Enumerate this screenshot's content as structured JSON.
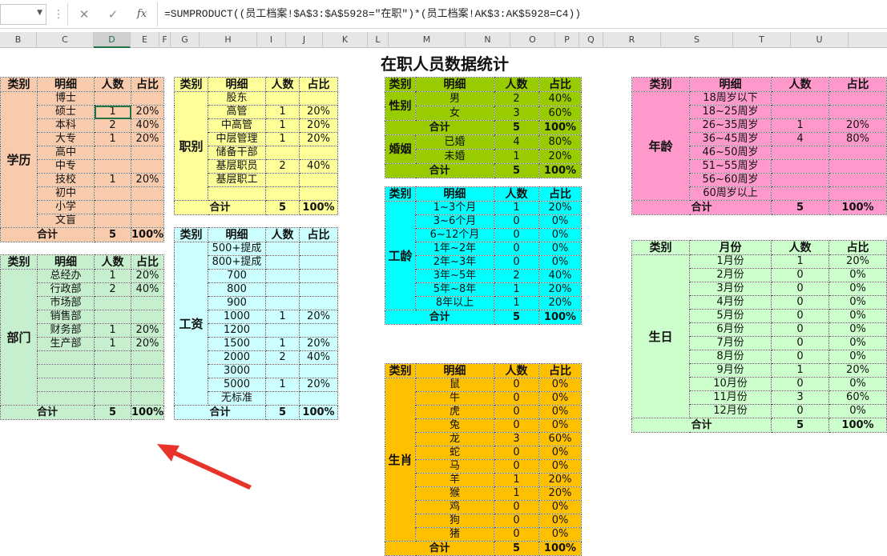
{
  "formula_bar": {
    "name_box": "",
    "cancel_icon": "✕",
    "enter_icon": "✓",
    "fx_icon": "fx",
    "formula": "=SUMPRODUCT((员工档案!$A$3:$A$5928=\"在职\")*(员工档案!AK$3:AK$5928=C4))"
  },
  "columns": [
    "B",
    "C",
    "D",
    "E",
    "F",
    "G",
    "H",
    "I",
    "J",
    "K",
    "L",
    "M",
    "N",
    "O",
    "P",
    "Q",
    "R",
    "S",
    "T",
    "U"
  ],
  "title": "在职人员数据统计",
  "headers": {
    "cat": "类别",
    "detail": "明细",
    "count": "人数",
    "pct": "占比",
    "month": "月份"
  },
  "total_label": "合计",
  "education": {
    "category": "学历",
    "rows": [
      {
        "d": "博士",
        "n": "",
        "p": ""
      },
      {
        "d": "硕士",
        "n": "1",
        "p": "20%"
      },
      {
        "d": "本科",
        "n": "2",
        "p": "40%"
      },
      {
        "d": "大专",
        "n": "1",
        "p": "20%"
      },
      {
        "d": "高中",
        "n": "",
        "p": ""
      },
      {
        "d": "中专",
        "n": "",
        "p": ""
      },
      {
        "d": "技校",
        "n": "1",
        "p": "20%"
      },
      {
        "d": "初中",
        "n": "",
        "p": ""
      },
      {
        "d": "小学",
        "n": "",
        "p": ""
      },
      {
        "d": "文盲",
        "n": "",
        "p": ""
      }
    ],
    "total_n": "5",
    "total_p": "100%",
    "color": "#f8cbad"
  },
  "department": {
    "category": "部门",
    "rows": [
      {
        "d": "总经办",
        "n": "1",
        "p": "20%"
      },
      {
        "d": "行政部",
        "n": "2",
        "p": "40%"
      },
      {
        "d": "市场部",
        "n": "",
        "p": ""
      },
      {
        "d": "销售部",
        "n": "",
        "p": ""
      },
      {
        "d": "财务部",
        "n": "1",
        "p": "20%"
      },
      {
        "d": "生产部",
        "n": "1",
        "p": "20%"
      },
      {
        "d": "",
        "n": "",
        "p": ""
      },
      {
        "d": "",
        "n": "",
        "p": ""
      },
      {
        "d": "",
        "n": "",
        "p": ""
      },
      {
        "d": "",
        "n": "",
        "p": ""
      }
    ],
    "total_n": "5",
    "total_p": "100%",
    "color": "#c6efce"
  },
  "rank": {
    "category": "职别",
    "rows": [
      {
        "d": "股东",
        "n": "",
        "p": ""
      },
      {
        "d": "高管",
        "n": "1",
        "p": "20%"
      },
      {
        "d": "中高管",
        "n": "1",
        "p": "20%"
      },
      {
        "d": "中层管理",
        "n": "1",
        "p": "20%"
      },
      {
        "d": "储备干部",
        "n": "",
        "p": ""
      },
      {
        "d": "基层职员",
        "n": "2",
        "p": "40%"
      },
      {
        "d": "基层职工",
        "n": "",
        "p": ""
      },
      {
        "d": "",
        "n": "",
        "p": ""
      }
    ],
    "total_n": "5",
    "total_p": "100%",
    "color": "#ffff99"
  },
  "salary": {
    "category": "工资",
    "rows": [
      {
        "d": "500+提成",
        "n": "",
        "p": ""
      },
      {
        "d": "800+提成",
        "n": "",
        "p": ""
      },
      {
        "d": "700",
        "n": "",
        "p": ""
      },
      {
        "d": "800",
        "n": "",
        "p": ""
      },
      {
        "d": "900",
        "n": "",
        "p": ""
      },
      {
        "d": "1000",
        "n": "1",
        "p": "20%"
      },
      {
        "d": "1200",
        "n": "",
        "p": ""
      },
      {
        "d": "1500",
        "n": "1",
        "p": "20%"
      },
      {
        "d": "2000",
        "n": "2",
        "p": "40%"
      },
      {
        "d": "3000",
        "n": "",
        "p": ""
      },
      {
        "d": "5000",
        "n": "1",
        "p": "20%"
      },
      {
        "d": "无标准",
        "n": "",
        "p": ""
      }
    ],
    "total_n": "5",
    "total_p": "100%",
    "color": "#ccffff"
  },
  "gender": {
    "category": "性别",
    "rows": [
      {
        "d": "男",
        "n": "2",
        "p": "40%"
      },
      {
        "d": "女",
        "n": "3",
        "p": "60%"
      }
    ],
    "total_n": "5",
    "total_p": "100%"
  },
  "marriage": {
    "category": "婚姻",
    "rows": [
      {
        "d": "已婚",
        "n": "4",
        "p": "80%"
      },
      {
        "d": "未婚",
        "n": "1",
        "p": "20%"
      }
    ],
    "total_n": "5",
    "total_p": "100%",
    "color": "#99cc00"
  },
  "seniority": {
    "category": "工龄",
    "rows": [
      {
        "d": "1~3个月",
        "n": "1",
        "p": "20%"
      },
      {
        "d": "3~6个月",
        "n": "0",
        "p": "0%"
      },
      {
        "d": "6~12个月",
        "n": "0",
        "p": "0%"
      },
      {
        "d": "1年~2年",
        "n": "0",
        "p": "0%"
      },
      {
        "d": "2年~3年",
        "n": "0",
        "p": "0%"
      },
      {
        "d": "3年~5年",
        "n": "2",
        "p": "40%"
      },
      {
        "d": "5年~8年",
        "n": "1",
        "p": "20%"
      },
      {
        "d": "8年以上",
        "n": "1",
        "p": "20%"
      }
    ],
    "total_n": "5",
    "total_p": "100%",
    "color": "#00ffff"
  },
  "zodiac": {
    "category": "生肖",
    "rows": [
      {
        "d": "鼠",
        "n": "0",
        "p": "0%"
      },
      {
        "d": "牛",
        "n": "0",
        "p": "0%"
      },
      {
        "d": "虎",
        "n": "0",
        "p": "0%"
      },
      {
        "d": "兔",
        "n": "0",
        "p": "0%"
      },
      {
        "d": "龙",
        "n": "3",
        "p": "60%"
      },
      {
        "d": "蛇",
        "n": "0",
        "p": "0%"
      },
      {
        "d": "马",
        "n": "0",
        "p": "0%"
      },
      {
        "d": "羊",
        "n": "1",
        "p": "20%"
      },
      {
        "d": "猴",
        "n": "1",
        "p": "20%"
      },
      {
        "d": "鸡",
        "n": "0",
        "p": "0%"
      },
      {
        "d": "狗",
        "n": "0",
        "p": "0%"
      },
      {
        "d": "猪",
        "n": "0",
        "p": "0%"
      }
    ],
    "total_n": "5",
    "total_p": "100%",
    "color": "#ffc000"
  },
  "age": {
    "category": "年龄",
    "rows": [
      {
        "d": "18周岁以下",
        "n": "",
        "p": ""
      },
      {
        "d": "18~25周岁",
        "n": "",
        "p": ""
      },
      {
        "d": "26~35周岁",
        "n": "1",
        "p": "20%"
      },
      {
        "d": "36~45周岁",
        "n": "4",
        "p": "80%"
      },
      {
        "d": "46~50周岁",
        "n": "",
        "p": ""
      },
      {
        "d": "51~55周岁",
        "n": "",
        "p": ""
      },
      {
        "d": "56~60周岁",
        "n": "",
        "p": ""
      },
      {
        "d": "60周岁以上",
        "n": "",
        "p": ""
      }
    ],
    "total_n": "5",
    "total_p": "100%",
    "color": "#ff99cc"
  },
  "birthday": {
    "category": "生日",
    "rows": [
      {
        "d": "1月份",
        "n": "1",
        "p": "20%"
      },
      {
        "d": "2月份",
        "n": "0",
        "p": "0%"
      },
      {
        "d": "3月份",
        "n": "0",
        "p": "0%"
      },
      {
        "d": "4月份",
        "n": "0",
        "p": "0%"
      },
      {
        "d": "5月份",
        "n": "0",
        "p": "0%"
      },
      {
        "d": "6月份",
        "n": "0",
        "p": "0%"
      },
      {
        "d": "7月份",
        "n": "0",
        "p": "0%"
      },
      {
        "d": "8月份",
        "n": "0",
        "p": "0%"
      },
      {
        "d": "9月份",
        "n": "1",
        "p": "20%"
      },
      {
        "d": "10月份",
        "n": "0",
        "p": "0%"
      },
      {
        "d": "11月份",
        "n": "3",
        "p": "60%"
      },
      {
        "d": "12月份",
        "n": "0",
        "p": "0%"
      }
    ],
    "total_n": "5",
    "total_p": "100%",
    "color": "#ccffcc"
  }
}
